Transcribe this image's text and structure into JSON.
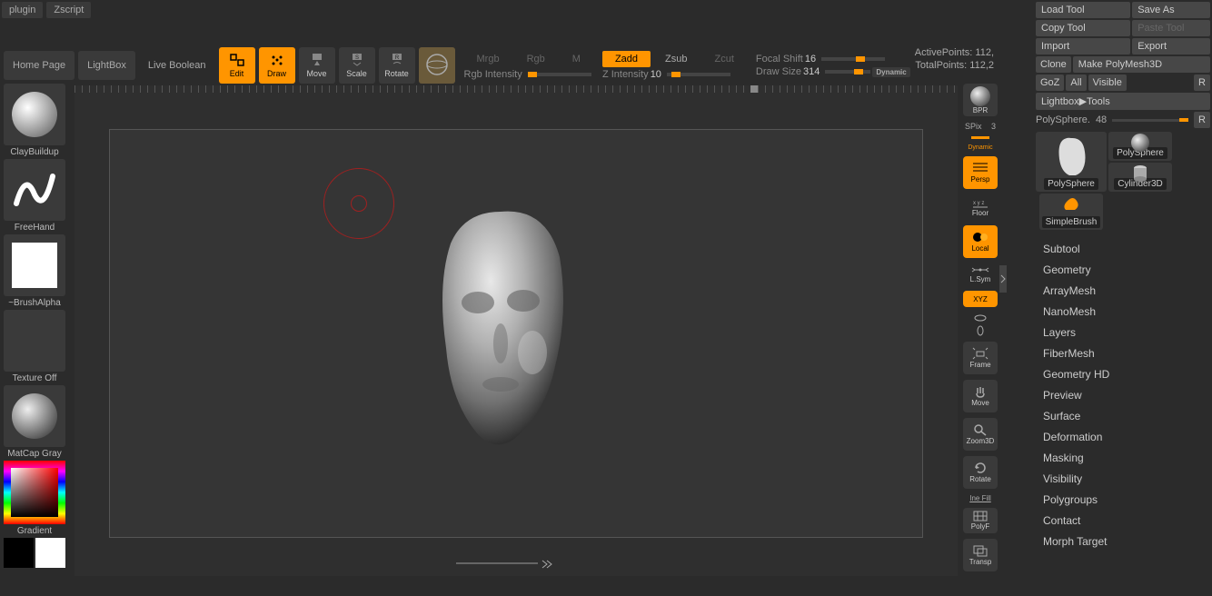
{
  "topmenu": {
    "plugin": "plugin",
    "zscript": "Zscript"
  },
  "toolbar": {
    "homepage": "Home Page",
    "lightbox": "LightBox",
    "liveboolean": "Live Boolean",
    "edit": "Edit",
    "draw": "Draw",
    "move": "Move",
    "scale": "Scale",
    "rotate": "Rotate"
  },
  "modes": {
    "mrgb": "Mrgb",
    "rgb": "Rgb",
    "m": "M",
    "rgbintensity": "Rgb Intensity",
    "zadd": "Zadd",
    "zsub": "Zsub",
    "zcut": "Zcut",
    "zintensity_label": "Z Intensity",
    "zintensity_val": "10",
    "focalshift_label": "Focal Shift",
    "focalshift_val": "16",
    "drawsize_label": "Draw Size",
    "drawsize_val": "314",
    "dynamic": "Dynamic"
  },
  "stats": {
    "active_label": "ActivePoints:",
    "active_val": "112,",
    "total_label": "TotalPoints:",
    "total_val": "112,2"
  },
  "leftbar": {
    "brush": "ClayBuildup",
    "stroke": "FreeHand",
    "alpha": "~BrushAlpha",
    "texture": "Texture Off",
    "material": "MatCap Gray",
    "gradient": "Gradient"
  },
  "righttools": {
    "bpr": "BPR",
    "spix_label": "SPix",
    "spix_val": "3",
    "persp": "Persp",
    "floor": "Floor",
    "local": "Local",
    "lsym": "L.Sym",
    "xyz": "XYZ",
    "frame": "Frame",
    "move": "Move",
    "zoom3d": "Zoom3D",
    "rotate": "Rotate",
    "polyf": "PolyF",
    "transp": "Transp",
    "inefill": "Ine Fill",
    "dynamic": "Dynamic"
  },
  "rightpanel": {
    "buttons": {
      "loadtool": "Load Tool",
      "saveas": "Save As",
      "copytool": "Copy Tool",
      "pastetool": "Paste Tool",
      "import": "Import",
      "export": "Export",
      "clone": "Clone",
      "makepolymesh": "Make PolyMesh3D",
      "goz": "GoZ",
      "all": "All",
      "visible": "Visible",
      "r1": "R",
      "lightboxtools": "Lightbox▶Tools",
      "polysphere_label": "PolySphere.",
      "polysphere_val": "48",
      "r2": "R"
    },
    "tools": {
      "polysphere1": "PolySphere",
      "polysphere2": "PolySphere",
      "cylinder3d": "Cylinder3D",
      "simplebrush": "SimpleBrush"
    },
    "accordion": [
      "Subtool",
      "Geometry",
      "ArrayMesh",
      "NanoMesh",
      "Layers",
      "FiberMesh",
      "Geometry HD",
      "Preview",
      "Surface",
      "Deformation",
      "Masking",
      "Visibility",
      "Polygroups",
      "Contact",
      "Morph Target"
    ]
  }
}
